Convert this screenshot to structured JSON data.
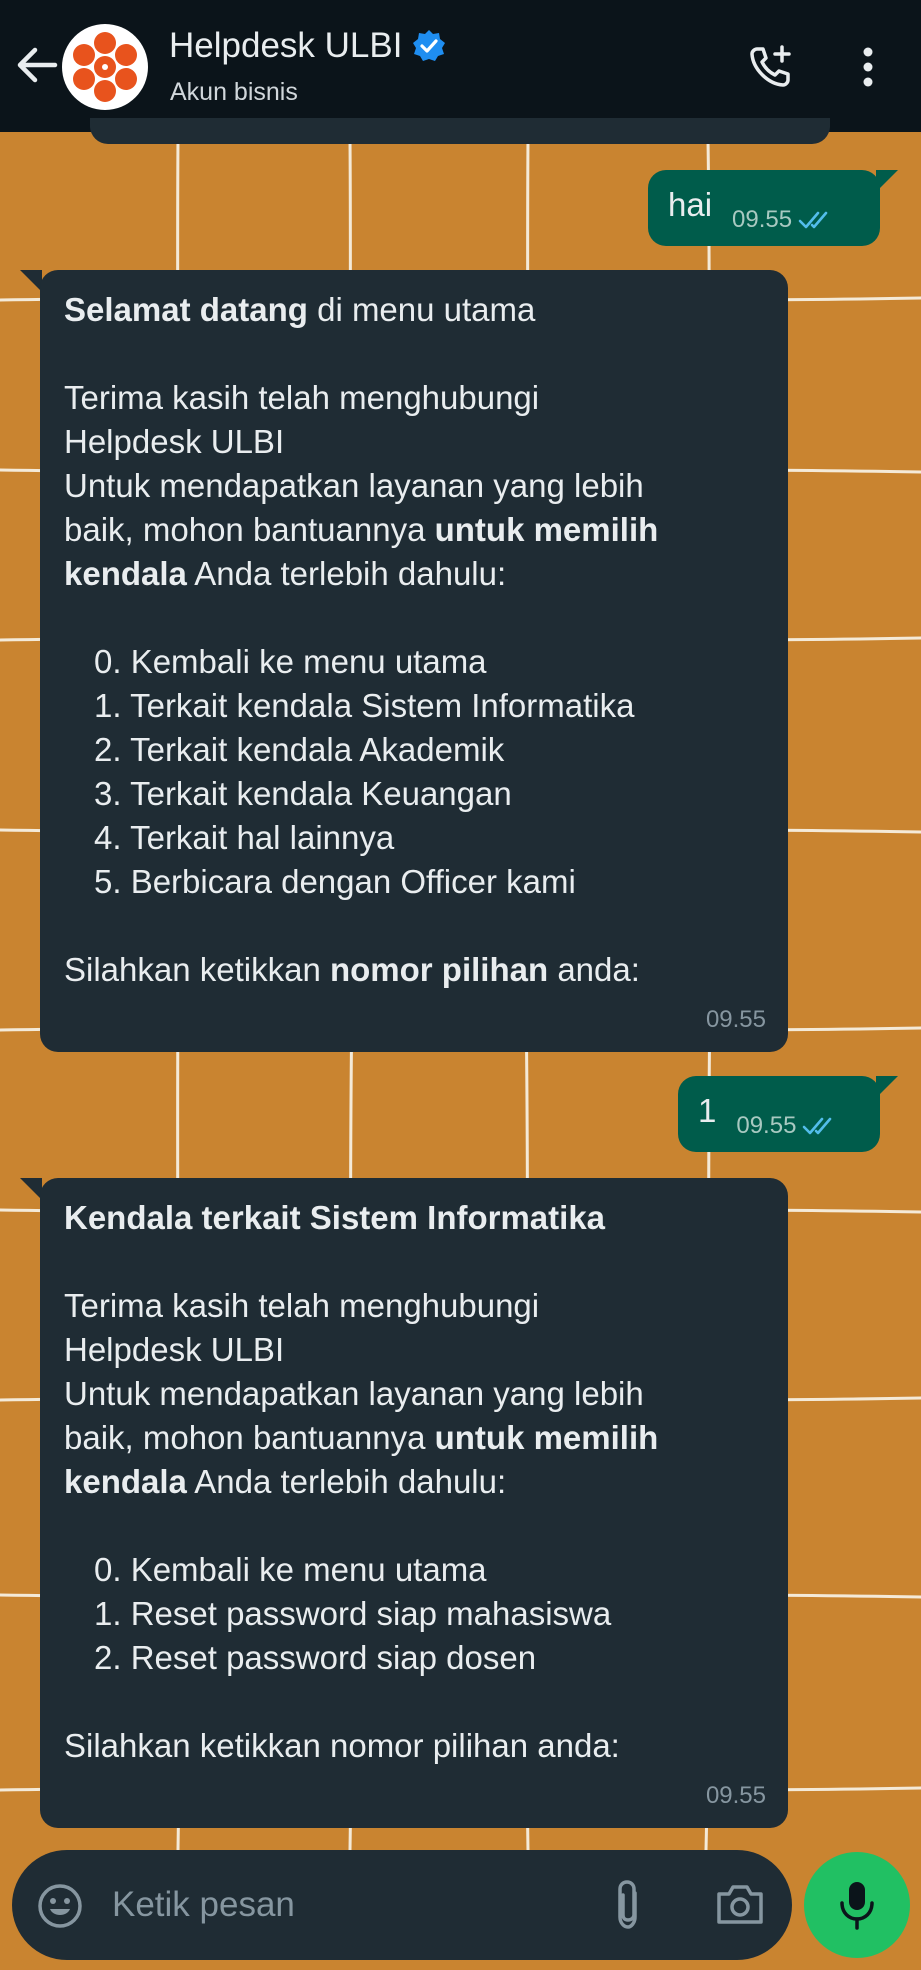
{
  "header": {
    "title": "Helpdesk ULBI",
    "subtitle": "Akun bisnis",
    "verified": true
  },
  "messages": {
    "m1": {
      "text": "hai",
      "time": "09.55"
    },
    "m2": {
      "heading_bold": "Selamat datang",
      "heading_rest": " di menu utama",
      "p1": "Terima kasih telah menghubungi",
      "p2": "Helpdesk ULBI",
      "p3": "Untuk mendapatkan layanan yang lebih",
      "p4_a": "baik, mohon bantuannya ",
      "p4_b": "untuk memilih",
      "p5_a": "kendala",
      "p5_b": " Anda terlebih dahulu:",
      "options": [
        "0. Kembali ke menu utama",
        "1. Terkait kendala Sistem Informatika",
        "2. Terkait kendala Akademik",
        "3. Terkait kendala Keuangan",
        "4. Terkait hal lainnya",
        "5. Berbicara dengan Officer kami"
      ],
      "footer_a": "Silahkan ketikkan ",
      "footer_b": "nomor pilihan",
      "footer_c": " anda:",
      "time": "09.55"
    },
    "m3": {
      "text": "1",
      "time": "09.55"
    },
    "m4": {
      "heading_bold": "Kendala terkait Sistem Informatika",
      "p1": "Terima kasih telah menghubungi",
      "p2": "Helpdesk ULBI",
      "p3": "Untuk mendapatkan layanan yang lebih",
      "p4_a": "baik, mohon bantuannya ",
      "p4_b": "untuk memilih",
      "p5_a": "kendala",
      "p5_b": " Anda terlebih dahulu:",
      "options": [
        "0. Kembali ke menu utama",
        "1. Reset password siap mahasiswa",
        "2. Reset password siap dosen"
      ],
      "footer": "Silahkan ketikkan nomor pilihan anda:",
      "time": "09.55"
    }
  },
  "composer": {
    "placeholder": "Ketik pesan"
  },
  "colors": {
    "header_bg": "#0b141a",
    "outgoing_bubble": "#005c4b",
    "incoming_bubble": "#1f2c34",
    "wallpaper": "#c98430",
    "read_ticks": "#53bdeb",
    "mic_button": "#21c063",
    "verified_badge": "#1f8ef1"
  },
  "icons": {
    "back": "arrow-left-icon",
    "verified": "verified-badge-icon",
    "call": "add-call-icon",
    "menu": "more-vertical-icon",
    "ticks": "double-check-icon",
    "emoji": "emoji-icon",
    "attach": "paperclip-icon",
    "camera": "camera-icon",
    "mic": "microphone-icon"
  }
}
